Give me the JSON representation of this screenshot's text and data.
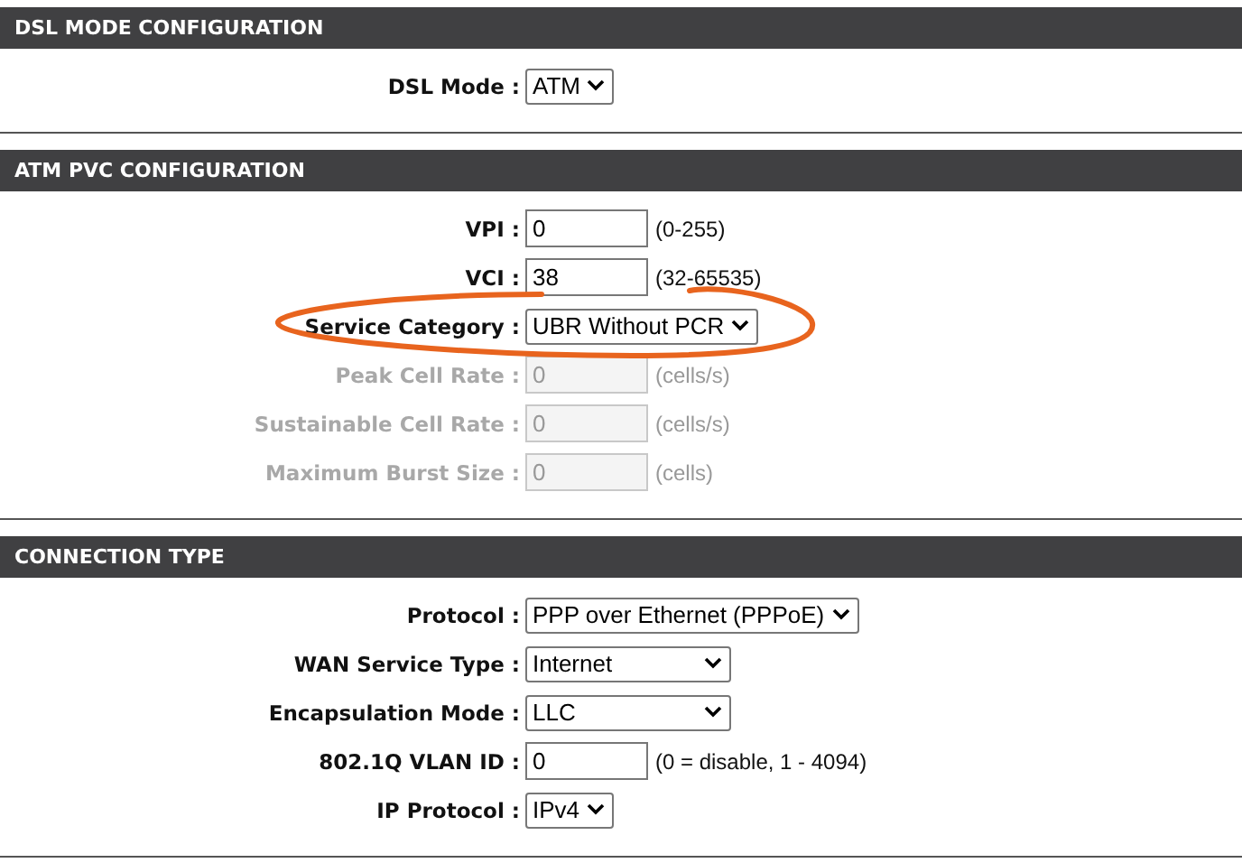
{
  "sections": [
    {
      "title": "DSL MODE CONFIGURATION",
      "rows": [
        {
          "label": "DSL Mode :",
          "kind": "select",
          "value": "ATM",
          "disabled": false
        }
      ]
    },
    {
      "title": "ATM PVC CONFIGURATION",
      "rows": [
        {
          "label": "VPI :",
          "kind": "input",
          "value": "0",
          "hint": "(0-255)",
          "disabled": false
        },
        {
          "label": "VCI :",
          "kind": "input",
          "value": "38",
          "hint": "(32-65535)",
          "disabled": false
        },
        {
          "label": "Service Category :",
          "kind": "select",
          "value": "UBR Without PCR",
          "disabled": false,
          "highlighted": true
        },
        {
          "label": "Peak Cell Rate :",
          "kind": "input",
          "value": "0",
          "hint": "(cells/s)",
          "disabled": true
        },
        {
          "label": "Sustainable Cell Rate :",
          "kind": "input",
          "value": "0",
          "hint": "(cells/s)",
          "disabled": true
        },
        {
          "label": "Maximum Burst Size :",
          "kind": "input",
          "value": "0",
          "hint": "(cells)",
          "disabled": true
        }
      ]
    },
    {
      "title": "CONNECTION TYPE",
      "rows": [
        {
          "label": "Protocol :",
          "kind": "select",
          "value": "PPP over Ethernet (PPPoE)",
          "disabled": false
        },
        {
          "label": "WAN Service Type :",
          "kind": "select",
          "value": "Internet",
          "disabled": false,
          "wide": true
        },
        {
          "label": "Encapsulation Mode :",
          "kind": "select",
          "value": "LLC",
          "disabled": false,
          "wide": true
        },
        {
          "label": "802.1Q VLAN ID :",
          "kind": "input",
          "value": "0",
          "hint": "(0 = disable, 1 - 4094)",
          "disabled": false
        },
        {
          "label": "IP Protocol :",
          "kind": "select",
          "value": "IPv4",
          "disabled": false
        }
      ]
    }
  ]
}
